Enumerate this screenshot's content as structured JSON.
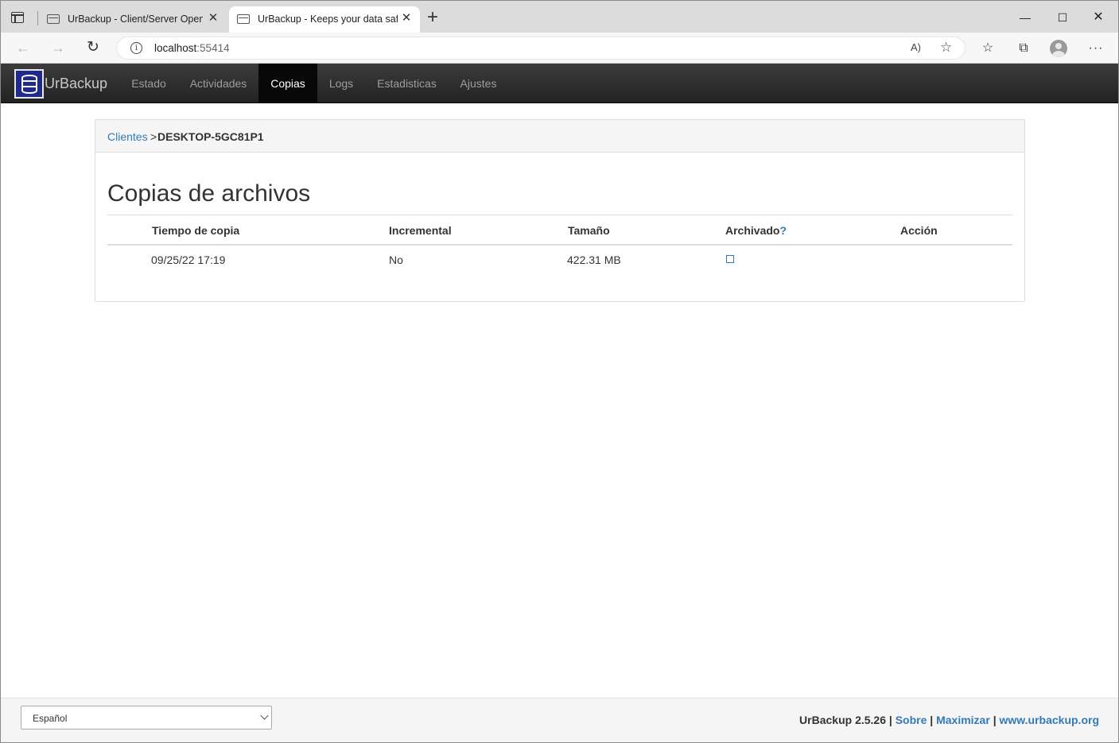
{
  "browser": {
    "tabs": [
      {
        "title": "UrBackup - Client/Server Open Source",
        "active": false
      },
      {
        "title": "UrBackup - Keeps your data safe",
        "active": true
      }
    ],
    "url_host": "localhost",
    "url_port": ":55414",
    "icons": {
      "tab_actions": "tab-actions-icon",
      "new_tab": "+",
      "close": "✕",
      "back": "←",
      "forward": "→",
      "reload": "↻",
      "minimize": "—",
      "maximize": "☐",
      "window_close": "✕",
      "read_aloud": "A)",
      "add_favorite": "☆",
      "favorites": "☆",
      "collections": "⧉",
      "more": "···",
      "info": "i"
    }
  },
  "app": {
    "brand": "UrBackup",
    "nav": [
      {
        "label": "Estado",
        "active": false
      },
      {
        "label": "Actividades",
        "active": false
      },
      {
        "label": "Copias",
        "active": true
      },
      {
        "label": "Logs",
        "active": false
      },
      {
        "label": "Estadisticas",
        "active": false
      },
      {
        "label": "Ajustes",
        "active": false
      }
    ],
    "accent_color": "#337ab7",
    "navbar_color": "#222222"
  },
  "breadcrumb": {
    "link": "Clientes",
    "separator": ">",
    "current": "DESKTOP-5GC81P1"
  },
  "section_title": "Copias de archivos",
  "table": {
    "headers": [
      "Tiempo de copia",
      "Incremental",
      "Tamaño",
      "Archivado",
      "Acción"
    ],
    "help_mark": "?",
    "rows": [
      {
        "time": "09/25/22 17:19",
        "incremental": "No",
        "size": "422.31 MB",
        "archived": false,
        "action": ""
      }
    ]
  },
  "footer": {
    "language": "Español",
    "version": "UrBackup 2.5.26",
    "sep": "|",
    "links": [
      "Sobre",
      "Maximizar",
      "www.urbackup.org"
    ]
  }
}
